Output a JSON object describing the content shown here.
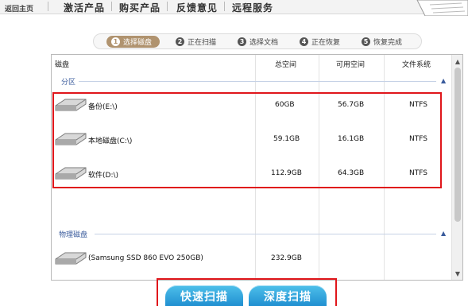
{
  "nav": {
    "home": "返回主页",
    "items": [
      "激活产品",
      "购买产品",
      "反馈意见",
      "远程服务"
    ]
  },
  "steps": [
    {
      "num": "1",
      "label": "选择磁盘",
      "active": true
    },
    {
      "num": "2",
      "label": "正在扫描",
      "active": false
    },
    {
      "num": "3",
      "label": "选择文档",
      "active": false
    },
    {
      "num": "4",
      "label": "正在恢复",
      "active": false
    },
    {
      "num": "5",
      "label": "恢复完成",
      "active": false
    }
  ],
  "table": {
    "headers": {
      "disk": "磁盘",
      "total": "总空间",
      "free": "可用空间",
      "fs": "文件系统"
    },
    "groups": {
      "partitions": "分区",
      "physical": "物理磁盘"
    },
    "partitions": [
      {
        "name": "备份(E:\\)",
        "total": "60GB",
        "free": "56.7GB",
        "fs": "NTFS"
      },
      {
        "name": "本地磁盘(C:\\)",
        "total": "59.1GB",
        "free": "16.1GB",
        "fs": "NTFS"
      },
      {
        "name": "软件(D:\\)",
        "total": "112.9GB",
        "free": "64.3GB",
        "fs": "NTFS"
      }
    ],
    "physical": [
      {
        "name": "(Samsung SSD 860 EVO 250GB)",
        "total": "232.9GB"
      }
    ]
  },
  "buttons": {
    "quick_scan": "快速扫描",
    "deep_scan": "深度扫描"
  },
  "colors": {
    "accent": "#1d8ccf",
    "step_active": "#b0936f",
    "highlight": "#e0161b",
    "group_text": "#3a5b9c"
  }
}
